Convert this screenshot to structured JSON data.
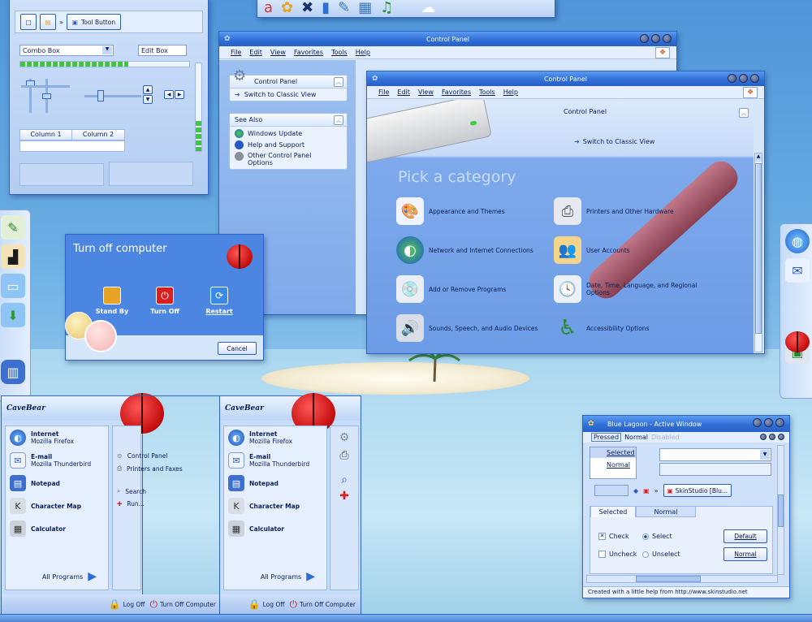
{
  "demo_window": {
    "tool_button": "Tool Button",
    "combo_box": "Combo Box",
    "edit_box": "Edit Box",
    "column1": "Column 1",
    "column2": "Column 2"
  },
  "cp_back": {
    "title": "Control Panel",
    "menu": [
      "File",
      "Edit",
      "View",
      "Favorites",
      "Tools",
      "Help"
    ],
    "panel_title": "Control Panel",
    "switch_view": "Switch to Classic View",
    "see_also": "See Also",
    "links": [
      "Windows Update",
      "Help and Support",
      "Other Control Panel Options"
    ]
  },
  "cp_front": {
    "title": "Control Panel",
    "menu": [
      "File",
      "Edit",
      "View",
      "Favorites",
      "Tools",
      "Help"
    ],
    "header": "Control Panel",
    "switch_view": "Switch to Classic View",
    "pick": "Pick a category",
    "categories": [
      "Appearance and Themes",
      "Printers and Other Hardware",
      "Network and Internet Connections",
      "User Accounts",
      "Add or Remove Programs",
      "Date, Time, Language, and Regional Options",
      "Sounds, Speech, and Audio Devices",
      "Accessibility Options"
    ]
  },
  "turnoff": {
    "title": "Turn off computer",
    "standby": "Stand By",
    "turnoff": "Turn Off",
    "restart": "Restart",
    "cancel": "Cancel"
  },
  "startmenu": {
    "user": "CaveBear",
    "internet": "Internet",
    "internet_app": "Mozilla Firefox",
    "email": "E-mail",
    "email_app": "Mozilla Thunderbird",
    "notepad": "Notepad",
    "charmap": "Character Map",
    "calc": "Calculator",
    "all_programs": "All Programs",
    "control_panel": "Control Panel",
    "printers": "Printers and Faxes",
    "search": "Search",
    "run": "Run...",
    "logoff": "Log Off",
    "turnoff": "Turn Off Computer"
  },
  "lagoon": {
    "title": "Blue Lagoon - Active Window",
    "tab_pressed": "Pressed",
    "tab_normal": "Normal",
    "tab_disabled": "Disabled",
    "list_selected": "Selected",
    "list_normal": "Normal",
    "skinstudio": "SkinStudio [Blu...",
    "subtab_selected": "Selected",
    "subtab_normal": "Normal",
    "check": "Check",
    "select": "Select",
    "uncheck": "Uncheck",
    "unselect": "Unselect",
    "btn_default": "Default",
    "btn_normal": "Normal",
    "status": "Created with a little help from http://www.skinstudio.net"
  },
  "colors": {
    "accent": "#2e63c9",
    "title": "#3170d8",
    "panel": "#d6e6fb"
  }
}
